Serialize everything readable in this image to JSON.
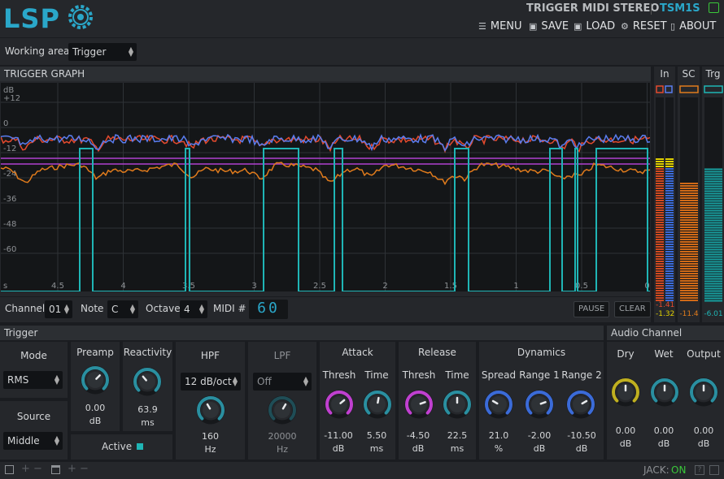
{
  "header": {
    "logo": "LSP",
    "plugin_title": "TRIGGER MIDI STEREO",
    "plugin_id": "TSM1S",
    "menu": [
      {
        "icon": "menu-icon",
        "label": "MENU"
      },
      {
        "icon": "save-icon",
        "label": "SAVE"
      },
      {
        "icon": "load-icon",
        "label": "LOAD"
      },
      {
        "icon": "reset-icon",
        "label": "RESET"
      },
      {
        "icon": "about-icon",
        "label": "ABOUT"
      }
    ]
  },
  "working_area": {
    "label": "Working area",
    "value": "Trigger"
  },
  "graph": {
    "title": "TRIGGER GRAPH",
    "y_unit": "dB",
    "y_ticks": [
      "+12",
      "0",
      "-12",
      "-24",
      "-36",
      "-48",
      "-60"
    ],
    "x_ticks": [
      "s",
      "4.5",
      "4",
      "3.5",
      "3",
      "2.5",
      "2",
      "1.5",
      "1",
      "0.5",
      "0"
    ],
    "colors": {
      "in_left": "#e44a2e",
      "in_right": "#5a7df0",
      "sidechain": "#e07b1c",
      "trigger": "#1fb5b5",
      "threshold": "#b040d0"
    }
  },
  "meters": {
    "in": {
      "label": "In",
      "value_left": "-1.41",
      "value_right": "-1.32",
      "level_left": 0.7,
      "level_right": 0.7
    },
    "sc": {
      "label": "SC",
      "value": "-11.4",
      "level": 0.58
    },
    "trg": {
      "label": "Trg",
      "value": "-6.01",
      "level": 0.65
    }
  },
  "controls": {
    "channel_label": "Channel",
    "channel_value": "01",
    "note_label": "Note",
    "note_value": "C",
    "octave_label": "Octave",
    "octave_value": "4",
    "midi_label": "MIDI #",
    "midi_value": "60",
    "pause_label": "PAUSE",
    "clear_label": "CLEAR"
  },
  "trigger": {
    "title": "Trigger",
    "mode": {
      "label": "Mode",
      "value": "RMS"
    },
    "source": {
      "label": "Source",
      "value": "Middle"
    },
    "preamp": {
      "label": "Preamp",
      "value": "0.00",
      "unit": "dB"
    },
    "reactivity": {
      "label": "Reactivity",
      "value": "63.9",
      "unit": "ms"
    },
    "active_label": "Active",
    "hpf": {
      "label": "HPF",
      "slope": "12 dB/oct",
      "value": "160",
      "unit": "Hz"
    },
    "lpf": {
      "label": "LPF",
      "slope": "Off",
      "value": "20000",
      "unit": "Hz"
    },
    "attack": {
      "title": "Attack",
      "thresh_label": "Thresh",
      "thresh_value": "-11.00",
      "thresh_unit": "dB",
      "time_label": "Time",
      "time_value": "5.50",
      "time_unit": "ms"
    },
    "release": {
      "title": "Release",
      "thresh_label": "Thresh",
      "thresh_value": "-4.50",
      "thresh_unit": "dB",
      "time_label": "Time",
      "time_value": "22.5",
      "time_unit": "ms"
    },
    "dynamics": {
      "title": "Dynamics",
      "spread_label": "Spread",
      "spread_value": "21.0",
      "spread_unit": "%",
      "range1_label": "Range 1",
      "range1_value": "-2.00",
      "range1_unit": "dB",
      "range2_label": "Range 2",
      "range2_value": "-10.50",
      "range2_unit": "dB"
    }
  },
  "audio_channel": {
    "title": "Audio Channel",
    "dry": {
      "label": "Dry",
      "value": "0.00",
      "unit": "dB"
    },
    "wet": {
      "label": "Wet",
      "value": "0.00",
      "unit": "dB"
    },
    "output": {
      "label": "Output",
      "value": "0.00",
      "unit": "dB"
    }
  },
  "footer": {
    "jack_label": "JACK:",
    "jack_status": "ON"
  }
}
